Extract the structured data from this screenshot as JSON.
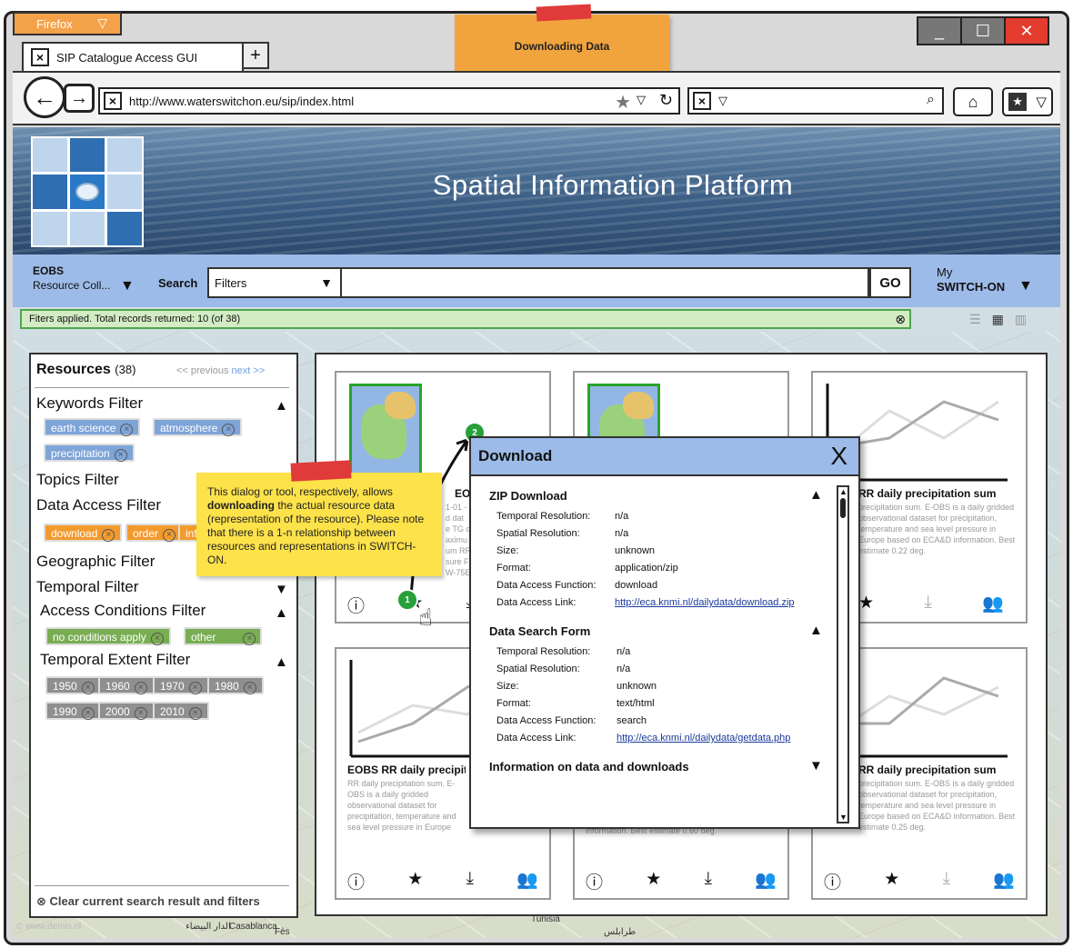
{
  "browser": {
    "app_button": "Firefox",
    "tab_title": "SIP Catalogue Access GUI",
    "url": "http://www.waterswitchon.eu/sip/index.html",
    "sticky_note": "Downloading Data"
  },
  "header": {
    "title": "Spatial Information Platform"
  },
  "search": {
    "collection_name": "EOBS",
    "collection_sub": "Resource Coll...",
    "label": "Search",
    "filters_value": "Filters",
    "go_label": "GO",
    "my_label": "My",
    "my_menu": "SWITCH-ON",
    "status": "Fiters applied. Total records returned: 10 (of 38)"
  },
  "sidebar": {
    "title": "Resources",
    "count": "(38)",
    "prev": "<< previous",
    "next": "next >>",
    "keywords_filter": "Keywords Filter",
    "keyword_chips": [
      "earth science",
      "atmosphere",
      "precipitation"
    ],
    "topics_filter": "Topics Filter",
    "data_access_filter": "Data Access Filter",
    "access_chips": [
      "download",
      "order",
      "inf"
    ],
    "geographic_filter": "Geographic Filter",
    "temporal_filter": "Temporal Filter",
    "access_conditions_filter": "Access Conditions Filter",
    "condition_chips": [
      "no conditions apply",
      "other"
    ],
    "temporal_extent_filter": "Temporal Extent Filter",
    "year_chips": [
      "1950",
      "1960",
      "1970",
      "1980",
      "1990",
      "2000",
      "2010"
    ],
    "clear": "Clear current search result and filters"
  },
  "cards": {
    "top_left_title": "EOBS RR daily precipitation dataset",
    "top_left_desc_lines": [
      "1-01 - 2",
      "d dat",
      "e TG d",
      "aximu",
      "um RR",
      "sure F",
      "W-75E"
    ],
    "top_right_title": "RR daily precipitation sum",
    "top_right_desc": "precipitation sum. E-OBS is a daily gridded observational dataset for precipitation, temperature and sea level pressure in Europe based on ECA&D information. Best estimate 0.22 deg.",
    "bottom_left_title": "EOBS RR daily precipitation sum",
    "bottom_left_desc": "RR daily precipitation sum. E-OBS is a daily gridded observational dataset for precipitation, temperature and sea level pressure in Europe based on ECA&D information. Best estimate 0.44 deg.",
    "bottom_mid_desc": "information. Best estimate 0.60 deg.",
    "bottom_right_title": "RR daily precipitation sum",
    "bottom_right_desc": "precipitation sum. E-OBS is a daily gridded observational dataset for precipitation, temperature and sea level pressure in Europe based on ECA&D information. Best estimate 0.25 deg."
  },
  "dialog": {
    "title": "Download",
    "close": "X",
    "zip_section": "ZIP Download",
    "zip": {
      "temporal_resolution": "n/a",
      "spatial_resolution": "n/a",
      "size": "unknown",
      "format": "application/zip",
      "function": "download",
      "link": "http://eca.knmi.nl/dailydata/download.zip"
    },
    "form_section": "Data Search Form",
    "form": {
      "temporal_resolution": "n/a",
      "spatial_resolution": "n/a",
      "size": "unknown",
      "format": "text/html",
      "function": "search",
      "link": "http://eca.knmi.nl/dailydata/getdata.php"
    },
    "info_section": "Information on data and downloads",
    "labels": {
      "temporal_resolution": "Temporal Resolution:",
      "spatial_resolution": "Spatial Resolution:",
      "size": "Size:",
      "format": "Format:",
      "function": "Data Access Function:",
      "link": "Data Access Link:"
    }
  },
  "note": {
    "text_before": "This dialog or tool, respectively, allows ",
    "bold": "downloading",
    "text_after": " the actual resource data (representation of the resource). Please note that there is a 1-n relationship between resources and representations in SWITCH-ON."
  },
  "badges": {
    "one": "1",
    "two": "2"
  },
  "map_labels": {
    "casablanca": "Casablanca",
    "fes": "Fès",
    "tunisia": "Tunisia",
    "arabic1": "الدار البيضاء",
    "arabic2": "طرابلس"
  },
  "watermark": "© www.demis.nl",
  "colors": {
    "accent_blue": "#9dbbe8",
    "status_green": "#4ea64c",
    "sticky_orange": "#f1a43e",
    "note_yellow": "#fde24a",
    "tape_red": "#e03a3a"
  }
}
